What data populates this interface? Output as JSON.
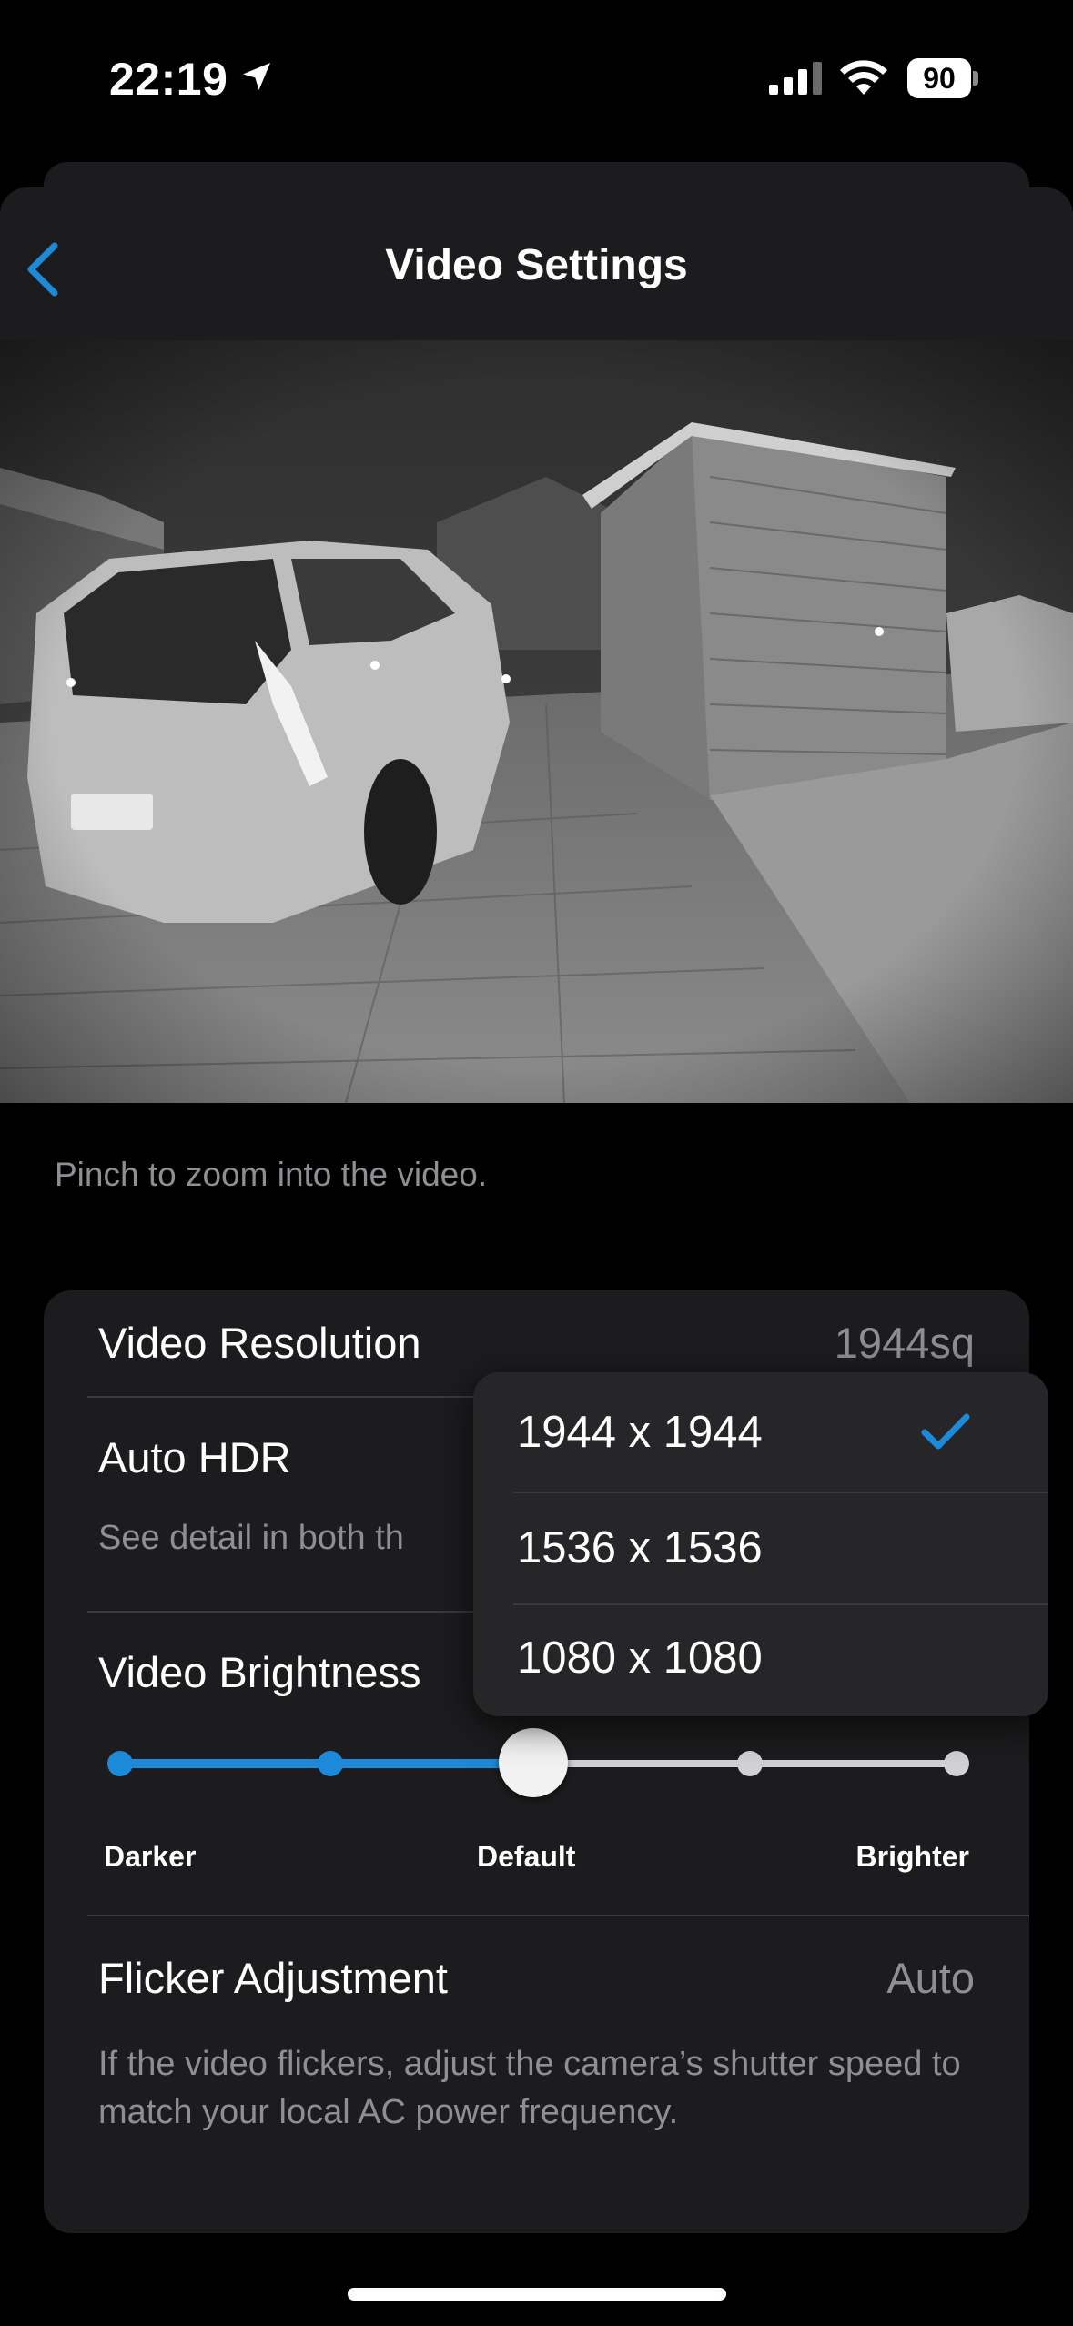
{
  "status_bar": {
    "time": "22:19",
    "battery": "90"
  },
  "nav": {
    "title": "Video Settings"
  },
  "hint": "Pinch to zoom into the video.",
  "settings": {
    "video_resolution": {
      "label": "Video Resolution",
      "value": "1944sq"
    },
    "auto_hdr": {
      "label": "Auto HDR",
      "description": "See detail in both th"
    },
    "video_brightness": {
      "label": "Video Brightness",
      "level_index": 2,
      "level_count": 5,
      "labels": {
        "min": "Darker",
        "mid": "Default",
        "max": "Brighter"
      }
    },
    "flicker": {
      "label": "Flicker Adjustment",
      "value": "Auto",
      "description": "If the video flickers, adjust the camera’s shutter speed to match your local AC power frequency."
    }
  },
  "resolution_menu": {
    "options": [
      "1944 x 1944",
      "1536 x 1536",
      "1080 x 1080"
    ],
    "selected": "1944 x 1944"
  },
  "colors": {
    "accent": "#1c8ad8",
    "card": "#1c1c1e",
    "secondary_text": "#8e8e93"
  }
}
